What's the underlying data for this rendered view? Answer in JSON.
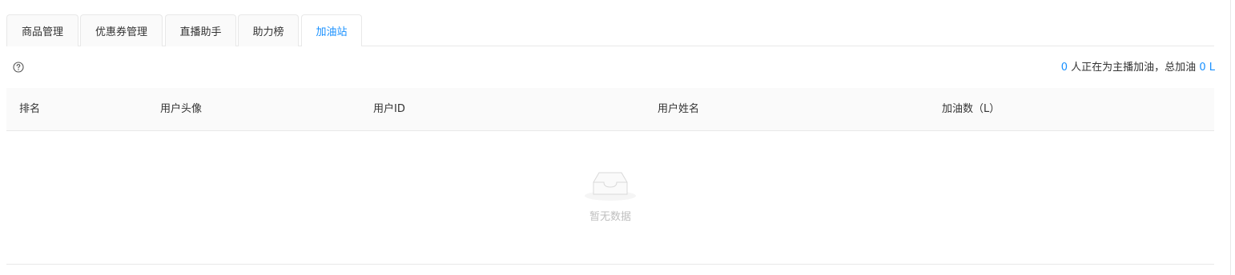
{
  "tabs": [
    {
      "label": "商品管理",
      "active": false
    },
    {
      "label": "优惠券管理",
      "active": false
    },
    {
      "label": "直播助手",
      "active": false
    },
    {
      "label": "助力榜",
      "active": false
    },
    {
      "label": "加油站",
      "active": true
    }
  ],
  "info": {
    "help_icon": "question-circle-icon",
    "people_count": "0",
    "people_text": "人正在为主播加油，总加油",
    "total_count": "0",
    "unit": "L"
  },
  "table": {
    "columns": [
      "排名",
      "用户头像",
      "用户ID",
      "用户姓名",
      "加油数（L）"
    ],
    "rows": []
  },
  "empty_state": {
    "icon": "empty-inbox-icon",
    "text": "暂无数据"
  },
  "colors": {
    "accent": "#1890ff",
    "border": "#e8e8e8",
    "header_bg": "#fafafa",
    "muted_text": "#bfbfbf"
  }
}
